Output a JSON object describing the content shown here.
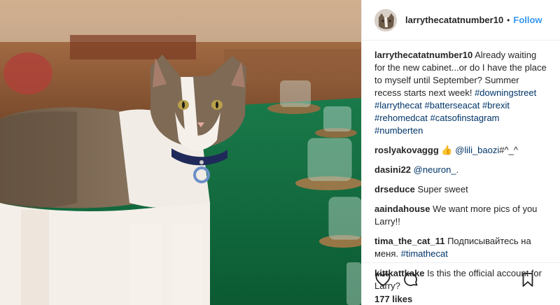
{
  "post": {
    "username": "larrythecatatnumber10",
    "follow_label": "Follow",
    "separator": "•",
    "caption": {
      "username": "larrythecatatnumber10",
      "text": "Already waiting for the new cabinet...or do I have the place to myself until September? Summer recess starts next week!",
      "hashtags": [
        "#downingstreet",
        "#larrythecat",
        "#batterseacat",
        "#brexit",
        "#rehomedcat",
        "#catsofinstagram",
        "#numberten"
      ]
    },
    "comments": [
      {
        "username": "roslyakovaggg",
        "pre": "👍 ",
        "mention": "@lili_baozi",
        "post": "#^_^"
      },
      {
        "username": "dasini22",
        "pre": "",
        "mention": "@neuron_",
        "post": "."
      },
      {
        "username": "drseduce",
        "pre": "Super sweet",
        "mention": "",
        "post": ""
      },
      {
        "username": "aaindahouse",
        "pre": "We want more pics of you Larry!!",
        "mention": "",
        "post": ""
      },
      {
        "username": "tima_the_cat_11",
        "pre": "Подписывайтесь на меня.",
        "mention": "#timathecat",
        "post": ""
      },
      {
        "username": "kittkattkake",
        "pre": "Is this the official account for Larry?",
        "mention": "",
        "post": ""
      }
    ],
    "likes": "177 likes",
    "icons": {
      "like": "heart-icon",
      "comment": "comment-icon",
      "save": "bookmark-icon"
    },
    "colors": {
      "link": "#003569",
      "follow": "#3897f0"
    }
  }
}
